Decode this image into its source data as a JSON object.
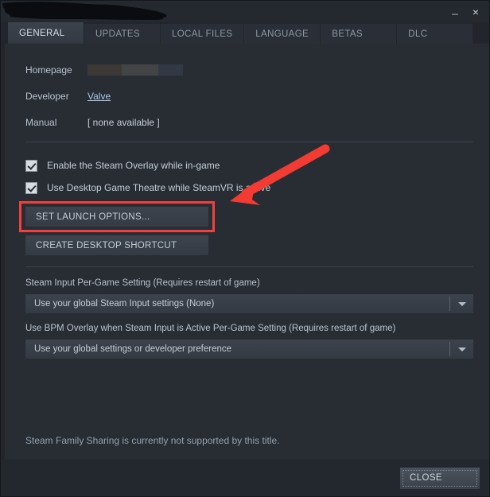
{
  "window": {
    "title": "",
    "title_redacted": true,
    "minimize_label": "_",
    "close_label": "×"
  },
  "tabs": [
    {
      "label": "GENERAL",
      "active": true
    },
    {
      "label": "UPDATES",
      "active": false
    },
    {
      "label": "LOCAL FILES",
      "active": false
    },
    {
      "label": "LANGUAGE",
      "active": false
    },
    {
      "label": "BETAS",
      "active": false
    },
    {
      "label": "DLC",
      "active": false
    }
  ],
  "info": {
    "homepage_label": "Homepage",
    "homepage_value": "",
    "developer_label": "Developer",
    "developer_value": "Valve",
    "manual_label": "Manual",
    "manual_value": "[ none available ]"
  },
  "checkboxes": [
    {
      "label": "Enable the Steam Overlay while in-game",
      "checked": true
    },
    {
      "label": "Use Desktop Game Theatre while SteamVR is active",
      "checked": true
    }
  ],
  "buttons": {
    "set_launch_options": "SET LAUNCH OPTIONS...",
    "create_desktop_shortcut": "CREATE DESKTOP SHORTCUT",
    "close": "CLOSE"
  },
  "steam_input": {
    "label": "Steam Input Per-Game Setting (Requires restart of game)",
    "value": "Use your global Steam Input settings (None)"
  },
  "bpm_overlay": {
    "label": "Use BPM Overlay when Steam Input is Active Per-Game Setting (Requires restart of game)",
    "value": "Use your global settings or developer preference"
  },
  "family_sharing": {
    "note": "Steam Family Sharing is currently not supported by this title."
  },
  "annotations": {
    "highlight_color": "#f04040",
    "arrow_color": "#f23b32",
    "highlight_target": "set-launch-options-button"
  },
  "colors": {
    "window_bg": "#23272e",
    "content_bg": "#282d34",
    "tab_active_bg": "#3b424b",
    "text_primary": "#c3ccd6",
    "link": "#a6c7e3"
  }
}
